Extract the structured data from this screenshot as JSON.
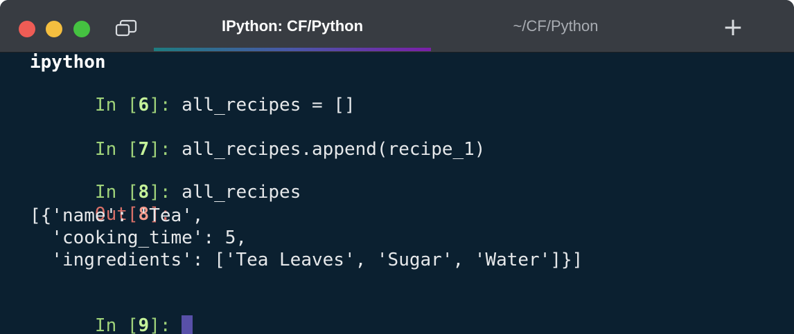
{
  "window": {
    "colors": {
      "close": "#ee5c55",
      "minimize": "#f4be3f",
      "zoom": "#45c241",
      "background": "#0b2030"
    }
  },
  "tabs": [
    {
      "label": "IPython: CF/Python",
      "active": true
    },
    {
      "label": "~/CF/Python",
      "active": false
    }
  ],
  "new_tab_label": "+",
  "terminal": {
    "command_line": "ipython",
    "cells": [
      {
        "prompt_open": "In [",
        "num": "6",
        "prompt_close": "]: ",
        "code": "all_recipes = []"
      },
      {
        "prompt_open": "In [",
        "num": "7",
        "prompt_close": "]: ",
        "code": "all_recipes.append(recipe_1)"
      },
      {
        "prompt_open": "In [",
        "num": "8",
        "prompt_close": "]: ",
        "code": "all_recipes"
      }
    ],
    "output": {
      "prompt_open": "Out[",
      "num": "8",
      "prompt_close": "]:",
      "lines": [
        "[{'name': 'Tea',",
        "  'cooking_time': 5,",
        "  'ingredients': ['Tea Leaves', 'Sugar', 'Water']}]"
      ]
    },
    "current_prompt": {
      "prompt_open": "In [",
      "num": "9",
      "prompt_close": "]: "
    }
  }
}
